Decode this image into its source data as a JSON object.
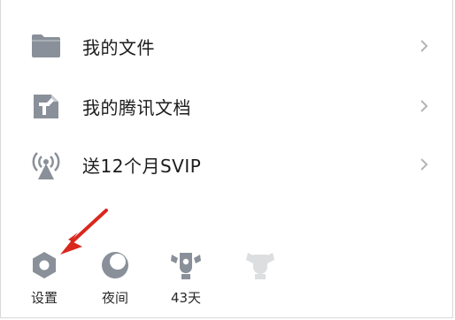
{
  "menu": {
    "items": [
      {
        "label": "我的文件",
        "icon": "folder-icon"
      },
      {
        "label": "我的腾讯文档",
        "icon": "tencent-docs-icon"
      },
      {
        "label": "送12个月SVIP",
        "icon": "broadcast-icon"
      }
    ]
  },
  "bottom_bar": {
    "items": [
      {
        "label": "设置",
        "icon": "gear-icon"
      },
      {
        "label": "夜间",
        "icon": "moon-icon"
      },
      {
        "label": "43天",
        "icon": "medal-icon"
      },
      {
        "label": "",
        "icon": "badge-icon"
      }
    ]
  },
  "colors": {
    "icon_gray": "#8a9099",
    "text": "#1c1c1c",
    "chevron": "#b5b5b5",
    "arrow_red": "#d9281e"
  }
}
